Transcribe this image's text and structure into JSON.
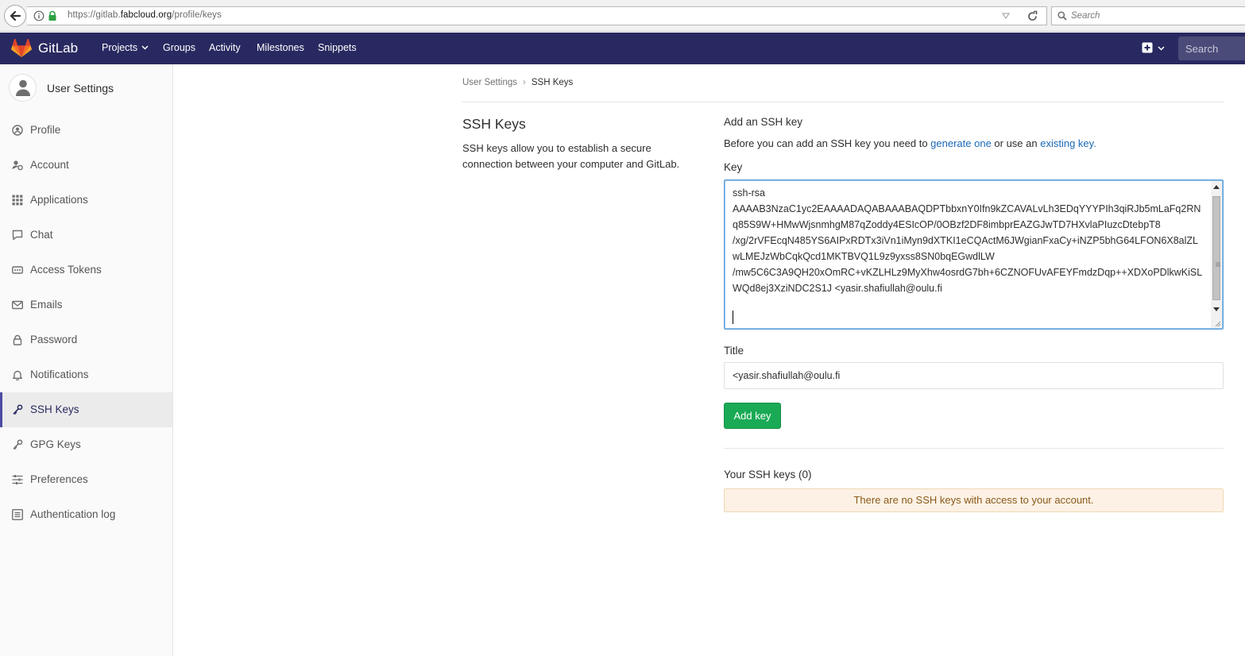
{
  "browser": {
    "url_prefix": "https://gitlab.",
    "url_host": "fabcloud.org",
    "url_path": "/profile/keys",
    "search_placeholder": "Search"
  },
  "navbar": {
    "brand": "GitLab",
    "links": [
      "Projects",
      "Groups",
      "Activity",
      "Milestones",
      "Snippets"
    ],
    "search_placeholder": "Search"
  },
  "sidebar": {
    "title": "User Settings",
    "items": [
      {
        "label": "Profile",
        "icon": "profile-icon"
      },
      {
        "label": "Account",
        "icon": "account-icon"
      },
      {
        "label": "Applications",
        "icon": "applications-icon"
      },
      {
        "label": "Chat",
        "icon": "chat-icon"
      },
      {
        "label": "Access Tokens",
        "icon": "access-tokens-icon"
      },
      {
        "label": "Emails",
        "icon": "emails-icon"
      },
      {
        "label": "Password",
        "icon": "lock-icon"
      },
      {
        "label": "Notifications",
        "icon": "bell-icon"
      },
      {
        "label": "SSH Keys",
        "icon": "key-icon",
        "active": true
      },
      {
        "label": "GPG Keys",
        "icon": "key-icon"
      },
      {
        "label": "Preferences",
        "icon": "sliders-icon"
      },
      {
        "label": "Authentication log",
        "icon": "list-icon"
      }
    ]
  },
  "breadcrumb": {
    "parent": "User Settings",
    "current": "SSH Keys"
  },
  "left": {
    "title": "SSH Keys",
    "description": "SSH keys allow you to establish a secure connection between your computer and GitLab."
  },
  "add_key": {
    "heading": "Add an SSH key",
    "instr_before": "Before you can add an SSH key you need to ",
    "link_generate": "generate one",
    "instr_middle": " or use an ",
    "link_existing": "existing key.",
    "key_label": "Key",
    "key_value": "ssh-rsa\nAAAAB3NzaC1yc2EAAAADAQABAAABAQDPTbbxnY0Ifn9kZCAVALvLh3EDqYYYPIh3qiRJb5mLaFq2RNq85S9W+HMwWjsnmhgM87qZoddy4ESIcOP/0OBzf2DF8imbprEAZGJwTD7HXvlaPIuzcDtebpT8\n/xg/2rVFEcqN485YS6AIPxRDTx3iVn1iMyn9dXTKI1eCQActM6JWgianFxaCy+iNZP5bhG64LFON6X8alZLwLMEJzWbCqkQcd1MKTBVQ1L9z9yxss8SN0bqEGwdlLW\n/mw5C6C3A9QH20xOmRC+vKZLHLz9MyXhw4osrdG7bh+6CZNOFUvAFEYFmdzDqp++XDXoPDlkwKiSLWQd8ej3XziNDC2S1J <yasir.shafiullah@oulu.fi\n",
    "title_label": "Title",
    "title_value": "<yasir.shafiullah@oulu.fi",
    "button_label": "Add key"
  },
  "your_keys": {
    "heading": "Your SSH keys (0)",
    "empty_message": "There are no SSH keys with access to your account."
  },
  "colors": {
    "navbar": "#292961",
    "link": "#1b69b6",
    "button": "#1aaa55",
    "warning_bg": "#fcf1e4"
  }
}
